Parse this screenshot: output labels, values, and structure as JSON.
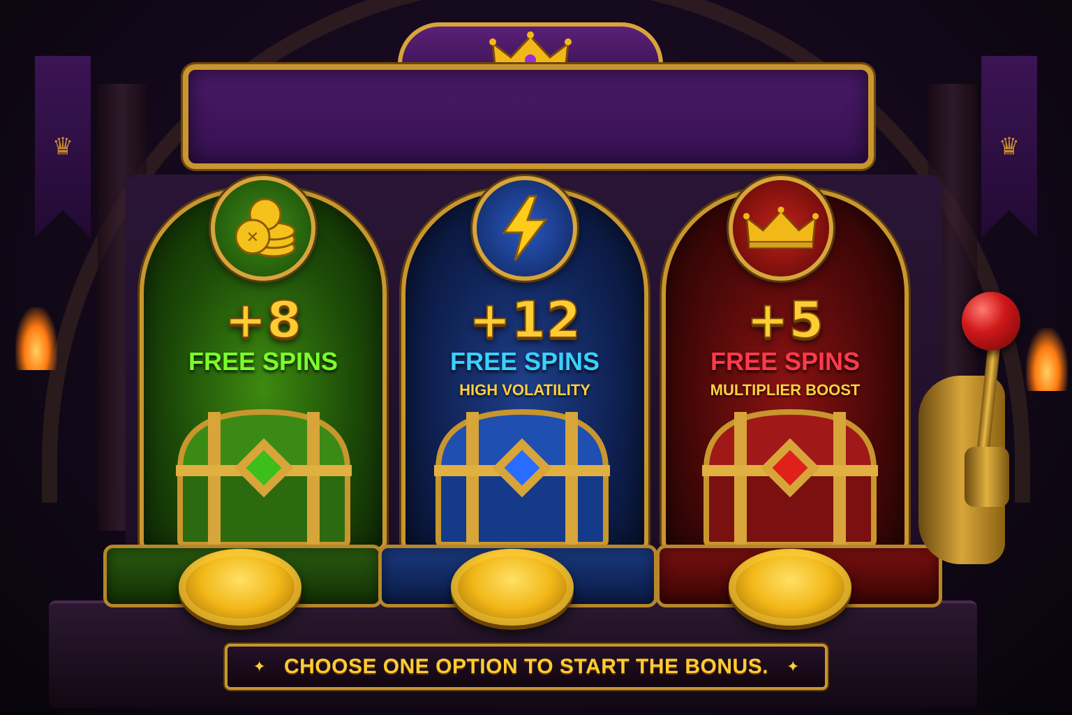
{
  "options": [
    {
      "id": "green",
      "count": "+8",
      "label": "FREE SPINS",
      "sub": "",
      "icon": "gold-coins-icon",
      "gem_color": "#3cbf1a",
      "theme_color": "#3d8a10"
    },
    {
      "id": "blue",
      "count": "+12",
      "label": "FREE SPINS",
      "sub": "HIGH VOLATILITY",
      "icon": "lightning-bolt-icon",
      "gem_color": "#2a6cff",
      "theme_color": "#1e3f8a"
    },
    {
      "id": "red",
      "count": "+5",
      "label": "FREE SPINS",
      "sub": "MULTIPLIER BOOST",
      "icon": "crown-icon",
      "gem_color": "#e0201a",
      "theme_color": "#8a1212"
    }
  ],
  "footer": {
    "instruction": "CHOOSE ONE OPTION TO START THE BONUS.",
    "decor_icon": "sparkle-icon"
  },
  "header": {
    "title_plaque": "",
    "crest_icon": "crown-icon"
  },
  "colors": {
    "gold": "#c9962e",
    "text_gold": "#ffcc33",
    "background": "#160a1e",
    "plaque": "#4a1a6a"
  }
}
